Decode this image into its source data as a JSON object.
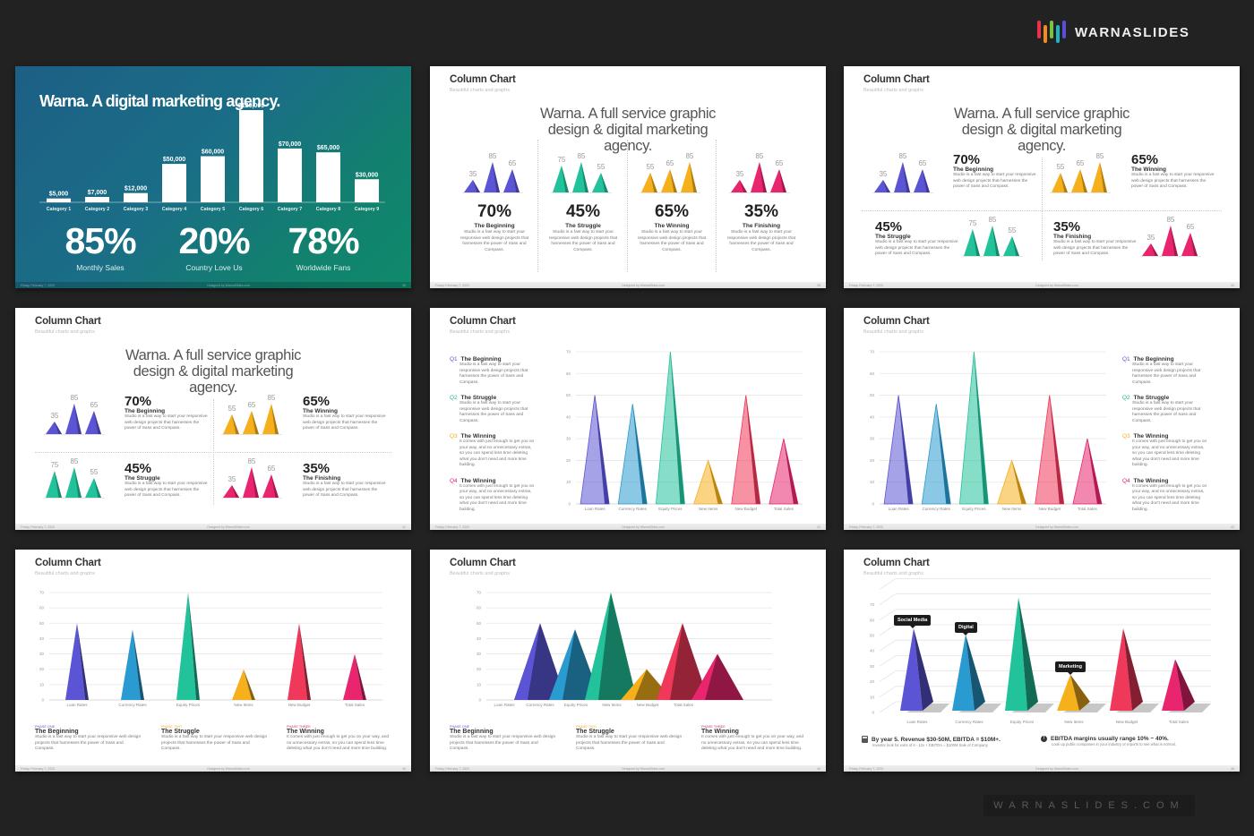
{
  "brand": {
    "name": "WARNASLIDES",
    "bar_colors": [
      "#e8334a",
      "#f58a1f",
      "#7cc242",
      "#1fb3c9",
      "#5b4fd6"
    ],
    "footer_url": "WARNASLIDES.COM"
  },
  "common": {
    "slide_title": "Column Chart",
    "slide_subtitle": "Beautiful charts and graphs",
    "headline": "Warna. A full service graphic design & digital marketing agency.",
    "footer_left": "Friday, February 7, 2020",
    "footer_center": "Designed by WarnaSlides.com",
    "desc_short": "Studio is a fast way to start your responsive web design projects that harnesses the power of Sass and Compass.",
    "desc_long": "It comes with just enough to get you on your way, and no unnecessary extras, so you can spend less time deleting what you don't need and more time building."
  },
  "colors": {
    "purple": "#5b55d6",
    "teal": "#22c39a",
    "yellow": "#f5b01c",
    "pink": "#e8256e",
    "blue": "#2a9bd0",
    "red": "#f0385a"
  },
  "slides": [
    {
      "id": 1,
      "title": "Warna. A digital marketing agency.",
      "page_num": "38",
      "stats": [
        {
          "value": "85%",
          "label": "Monthly Sales"
        },
        {
          "value": "20%",
          "label": "Country Love Us"
        },
        {
          "value": "78%",
          "label": "Worldwide Fans"
        }
      ]
    },
    {
      "id": 2,
      "page_num": "39",
      "groups": [
        {
          "pct": "70%",
          "name": "The Beginning",
          "values": [
            35,
            85,
            65
          ],
          "color": "purple"
        },
        {
          "pct": "45%",
          "name": "The Struggle",
          "values": [
            75,
            85,
            55
          ],
          "color": "teal"
        },
        {
          "pct": "65%",
          "name": "The Winning",
          "values": [
            55,
            65,
            85
          ],
          "color": "yellow"
        },
        {
          "pct": "35%",
          "name": "The Finishing",
          "values": [
            35,
            85,
            65
          ],
          "color": "pink"
        }
      ]
    },
    {
      "id": 3,
      "page_num": "40",
      "groups": [
        {
          "pct": "70%",
          "name": "The Beginning",
          "values": [
            35,
            85,
            65
          ],
          "color": "purple"
        },
        {
          "pct": "65%",
          "name": "The Winning",
          "values": [
            55,
            65,
            85
          ],
          "color": "yellow"
        },
        {
          "pct": "45%",
          "name": "The Struggle",
          "values": [
            75,
            85,
            55
          ],
          "color": "teal"
        },
        {
          "pct": "35%",
          "name": "The Finishing",
          "values": [
            35,
            85,
            65
          ],
          "color": "pink"
        }
      ]
    },
    {
      "id": 4,
      "page_num": "41",
      "groups": [
        {
          "pct": "70%",
          "name": "The Beginning",
          "values": [
            35,
            85,
            65
          ],
          "color": "purple"
        },
        {
          "pct": "65%",
          "name": "The Winning",
          "values": [
            55,
            65,
            85
          ],
          "color": "yellow"
        },
        {
          "pct": "45%",
          "name": "The Struggle",
          "values": [
            75,
            85,
            55
          ],
          "color": "teal"
        },
        {
          "pct": "35%",
          "name": "The Finishing",
          "values": [
            35,
            85,
            65
          ],
          "color": "pink"
        }
      ]
    },
    {
      "id": 5,
      "page_num": "42",
      "quarters": [
        {
          "q": "Q1",
          "name": "The Beginning",
          "desc": "short",
          "color": "#5b55d6"
        },
        {
          "q": "Q2",
          "name": "The Struggle",
          "desc": "short",
          "color": "#22b89a"
        },
        {
          "q": "Q3",
          "name": "The Winning",
          "desc": "long",
          "color": "#f5b01c"
        },
        {
          "q": "Q4",
          "name": "The Winning",
          "desc": "long",
          "color": "#d6257a"
        }
      ]
    },
    {
      "id": 6,
      "page_num": "43"
    },
    {
      "id": 7,
      "page_num": "44",
      "phases": [
        {
          "label": "PHASE ONE",
          "name": "The Beginning",
          "desc": "Studio is a fast way to start your responsive web design projects that harnesses the power of Sass and Compass.",
          "color": "#5b55d6"
        },
        {
          "label": "PHASE TWO",
          "name": "The Struggle",
          "desc": "Studio is a fast way to start your responsive web design projects that harnesses the power of Sass and Compass.",
          "color": "#f5b01c"
        },
        {
          "label": "PHASE THREE",
          "name": "The Winning",
          "desc": "It comes with just enough to get you on your way, and no unnecessary extras, so you can spend less time deleting what you don't need and more time building.",
          "color": "#d6257a"
        }
      ]
    },
    {
      "id": 8,
      "page_num": "45"
    },
    {
      "id": 9,
      "page_num": "46",
      "tooltips": [
        {
          "label": "Social Media",
          "category": "Loan Rates"
        },
        {
          "label": "Digital",
          "category": "Currency Rates"
        },
        {
          "label": "Marketing",
          "category": "New Items"
        }
      ],
      "notes": [
        {
          "icon": "calculator-icon",
          "title": "By year 5. Revenue $30-50M, EBITDA = $10M+.",
          "desc": "Investor look for exits of 6 - 12x + EBITDA = $100M Sale of Company."
        },
        {
          "icon": "info-icon",
          "title": "EBITDA margins usually range 10% ~ 40%.",
          "desc": "Look up public companies in your industry or reports to see what is normal."
        }
      ]
    }
  ],
  "chart_data": [
    {
      "type": "bar",
      "title": "Warna. A digital marketing agency.",
      "categories": [
        "Category 1",
        "Category 2",
        "Category 3",
        "Category 4",
        "Category 5",
        "Category 6",
        "Category 7",
        "Category 8",
        "Category 9"
      ],
      "values": [
        5000,
        7000,
        12000,
        50000,
        60000,
        120000,
        70000,
        65000,
        30000
      ],
      "data_labels": [
        "$5,000",
        "$7,000",
        "$12,000",
        "$50,000",
        "$60,000",
        "$120,000",
        "$70,000",
        "$65,000",
        "$30,000"
      ],
      "ylim": [
        0,
        120000
      ],
      "grid": false
    },
    {
      "type": "bar",
      "title": "Column Chart",
      "categories": [
        "Loan Rates",
        "Currency Rates",
        "Equity Prices",
        "New Items",
        "New Budget",
        "Total Sales"
      ],
      "values": [
        50,
        46,
        70,
        20,
        50,
        30
      ],
      "yticks": [
        0,
        10,
        20,
        30,
        40,
        50,
        60,
        70
      ],
      "ylim": [
        0,
        70
      ],
      "grid": true,
      "bar_colors": [
        "#5b55d6",
        "#2a9bd0",
        "#22c39a",
        "#f5b01c",
        "#f0385a",
        "#e8256e"
      ]
    }
  ]
}
